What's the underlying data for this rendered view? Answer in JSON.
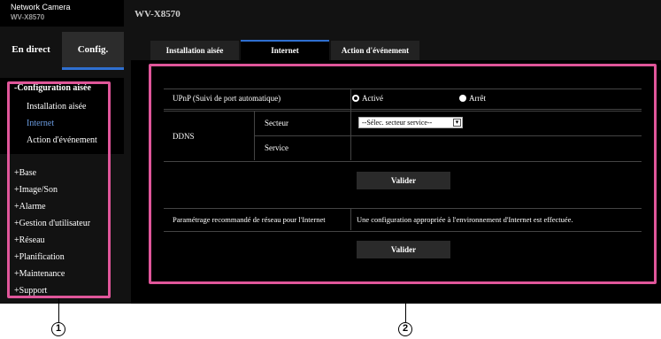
{
  "header": {
    "app_title": "Network Camera",
    "model_small": "WV-X8570",
    "model_large": "WV-X8570"
  },
  "tabs": {
    "live": "En direct",
    "config": "Config."
  },
  "sidebar": {
    "easy_title": "-Configuration aisée",
    "easy_items": [
      {
        "label": "Installation aisée"
      },
      {
        "label": "Internet"
      },
      {
        "label": "Action d'événement"
      }
    ],
    "main_items": [
      {
        "label": "+Base"
      },
      {
        "label": "+Image/Son"
      },
      {
        "label": "+Alarme"
      },
      {
        "label": "+Gestion d'utilisateur"
      },
      {
        "label": "+Réseau"
      },
      {
        "label": "+Planification"
      },
      {
        "label": "+Maintenance"
      },
      {
        "label": "+Support"
      }
    ]
  },
  "content_tabs": [
    {
      "label": "Installation aisée"
    },
    {
      "label": "Internet"
    },
    {
      "label": "Action d'événement"
    }
  ],
  "form": {
    "upnp_label": "UPnP (Suivi de port automatique)",
    "upnp_on": "Activé",
    "upnp_off": "Arrêt",
    "ddns_label": "DDNS",
    "secteur_label": "Secteur",
    "secteur_value": "--Sélec. secteur service--",
    "service_label": "Service",
    "apply1": "Valider",
    "recommended_label": "Paramétrage recommandé de réseau pour l'Internet",
    "recommended_desc": "Une configuration appropriée à l'environnement d'Internet est effectuée.",
    "apply2": "Valider"
  },
  "callouts": {
    "one": "1",
    "two": "2"
  }
}
